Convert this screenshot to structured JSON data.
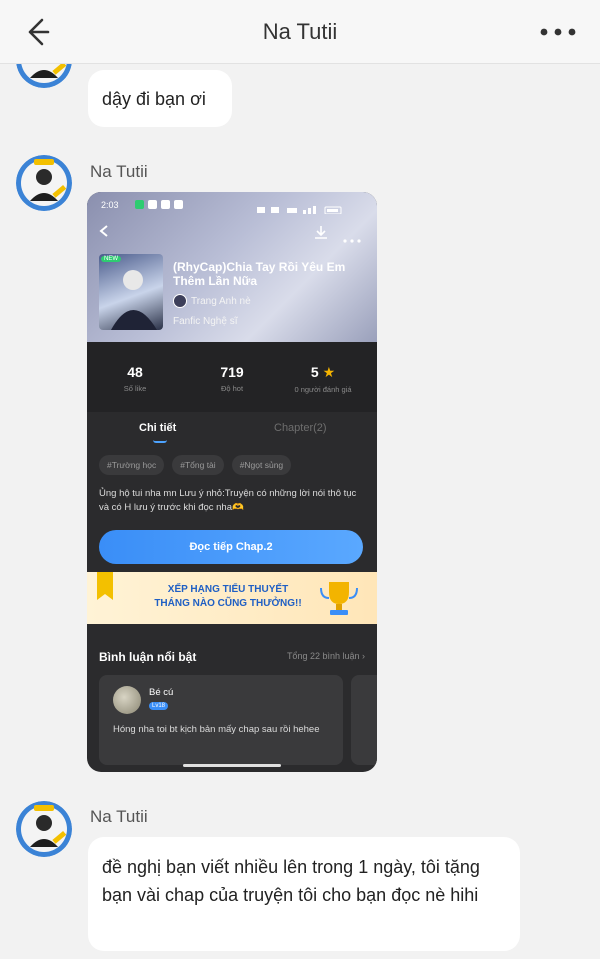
{
  "header": {
    "title": "Na Tutii"
  },
  "messages": {
    "first_text": "dậy đi bạn ơi",
    "sender_name": "Na Tutii",
    "last_text": "đề nghị bạn viết nhiều lên trong 1 ngày, tôi tặng bạn vài chap của truyện tôi cho bạn đọc nè hihi"
  },
  "shot": {
    "status_time": "2:03",
    "cover_badge": "NEW",
    "title": "(RhyCap)Chia Tay Rồi Yêu Em Thêm Lần Nữa",
    "author": "Trang Anh nè",
    "tagline": "Fanfic Nghệ sĩ",
    "stats": [
      {
        "value": "48",
        "label": "Số like"
      },
      {
        "value": "719",
        "label": "Độ hot"
      },
      {
        "value": "5",
        "label": "0 người đánh giá"
      }
    ],
    "tabs": {
      "detail": "Chi tiết",
      "chapters": "Chapter(2)"
    },
    "tags": [
      "#Trường học",
      "#Tổng tài",
      "#Ngọt sủng"
    ],
    "description": "Ủng hộ tui nha mn Lưu ý nhỏ:Truyện có những lời nói thô tục và có H lưu ý trước khi đọc nha🫶",
    "read_button": "Đọc tiếp Chap.2",
    "banner_line1": "XẾP HẠNG TIỂU THUYẾT",
    "banner_line2": "THÁNG NÀO CŨNG THƯỞNG!!",
    "comments_title": "Bình luận nổi bật",
    "comments_total": "Tổng 22 bình luận",
    "comment": {
      "user": "Bé cú",
      "level": "Lv18",
      "text": "Hóng nha toi bt kịch bản mấy chap sau rồi hehee"
    }
  },
  "colors": {
    "accent": "#3a8ef7",
    "star": "#f5b400"
  }
}
